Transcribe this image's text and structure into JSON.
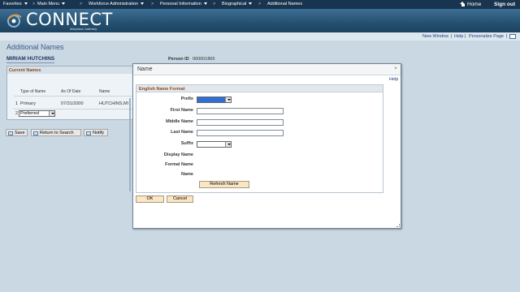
{
  "topnav": {
    "favorites": "Favorites",
    "main_menu": "Main Menu",
    "workforce": "Workforce Administration",
    "personal_info": "Personal Information",
    "biographical": "Biographical",
    "additional_names": "Additional Names",
    "separator": ">",
    "home": "Home",
    "sign_out": "Sign out"
  },
  "banner": {
    "logo_text": "CONNECT",
    "logo_sub": "Maryland Judiciary"
  },
  "pagebar": {
    "new_window": "New Window",
    "help": "Help",
    "personalize": "Personalize Page",
    "sep": "|"
  },
  "page": {
    "title": "Additional Names",
    "person_name": "MIRIAM HUTCHINS",
    "person_id_label": "Person ID",
    "person_id_value": "000001865"
  },
  "current_names": {
    "title": "Current Names",
    "headers": [
      "Type of Name",
      "As Of Date",
      "Name"
    ],
    "rows": [
      {
        "num": "1",
        "type": "Primary",
        "date": "07/31/2000",
        "name": "HUTCHINS,MI"
      },
      {
        "num": "2",
        "type": "Preferred",
        "date": "",
        "name": ""
      }
    ]
  },
  "buttons": {
    "save": "Save",
    "return_to_search": "Return to Search",
    "notify": "Notify"
  },
  "modal": {
    "title": "Name",
    "close": "×",
    "help": "Help",
    "section_title": "English Name Format",
    "fields": {
      "prefix": "Prefix",
      "first_name": "First Name",
      "middle_name": "Middle Name",
      "last_name": "Last Name",
      "suffix": "Suffix",
      "display_name": "Display Name",
      "formal_name": "Formal Name",
      "name": "Name"
    },
    "values": {
      "first_name": "",
      "middle_name": "",
      "last_name": ""
    },
    "refresh": "Refresh Name",
    "ok": "OK",
    "cancel": "Cancel"
  },
  "colors": {
    "nav_bg": "#19344f",
    "banner_bg": "#24506f",
    "section_title": "#8d4b1d",
    "button_bg": "#fbe6c3",
    "focused_select": "#2f6fd6"
  }
}
